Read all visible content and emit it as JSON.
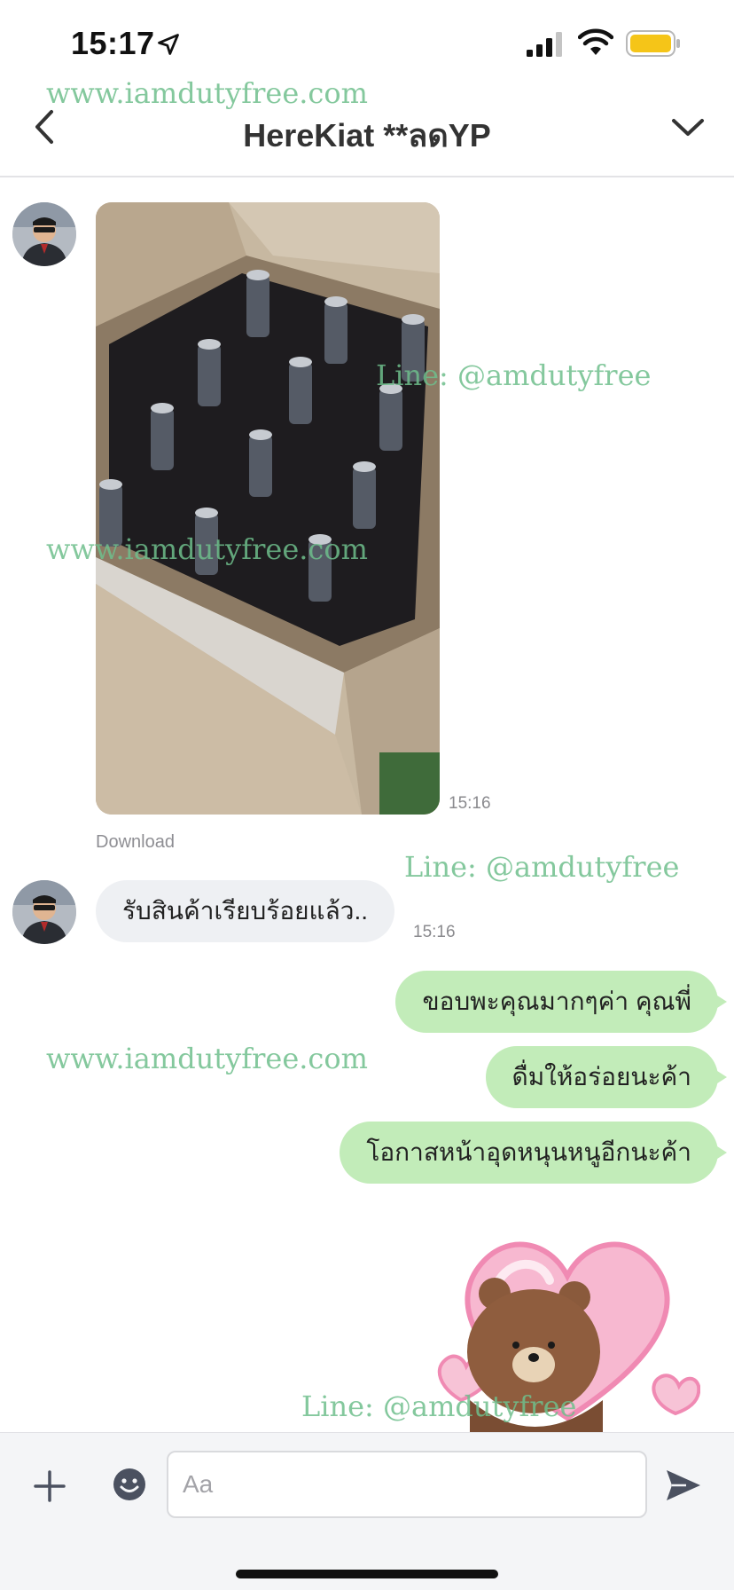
{
  "status_bar": {
    "time": "15:17",
    "icons": [
      "location-arrow-icon",
      "signal-icon",
      "wifi-icon",
      "battery-icon"
    ],
    "battery_color": "#f5c518"
  },
  "header": {
    "title": "HereKiat **ลดYP",
    "back_icon": "chevron-left-icon",
    "dropdown_icon": "chevron-down-icon"
  },
  "watermarks": {
    "site": "www.iamdutyfree.com",
    "line": "Line: @amdutyfree"
  },
  "messages": {
    "photo": {
      "time": "15:16",
      "download_label": "Download",
      "description": "opened cardboard box of wine bottles"
    },
    "incoming_text": {
      "text": "รับสินค้าเรียบร้อยแล้ว..",
      "time": "15:16"
    },
    "outgoing": [
      {
        "text": "ขอบพะคุณมากๆค่า คุณพี่"
      },
      {
        "text": "ดื่มให้อร่อยนะค้า"
      },
      {
        "text": "โอกาสหน้าอุดหนุนหนูอีกนะค้า"
      }
    ],
    "sticker": "brown-bear-heart-sticker"
  },
  "input_bar": {
    "placeholder": "Aa",
    "plus_icon": "plus-icon",
    "emoji_icon": "emoji-icon",
    "send_icon": "send-icon"
  },
  "colors": {
    "outgoing_bubble": "#c2ecb9",
    "incoming_bubble": "#eef0f3",
    "watermark": "#6ebe8c"
  }
}
